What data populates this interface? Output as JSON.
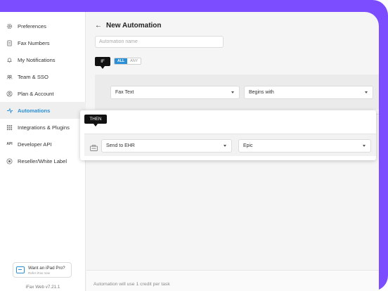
{
  "sidebar": {
    "items": [
      {
        "label": "Preferences",
        "icon": "gear-icon"
      },
      {
        "label": "Fax Numbers",
        "icon": "fax-icon"
      },
      {
        "label": "My Notifications",
        "icon": "bell-icon"
      },
      {
        "label": "Team & SSO",
        "icon": "team-icon"
      },
      {
        "label": "Plan & Account",
        "icon": "account-icon"
      },
      {
        "label": "Automations",
        "icon": "automation-icon",
        "active": true
      },
      {
        "label": "Integrations & Plugins",
        "icon": "grid-icon"
      },
      {
        "label": "Developer API",
        "icon": "api-icon"
      },
      {
        "label": "Reseller/White Label",
        "icon": "globe-icon"
      }
    ],
    "promo": {
      "title": "Want an iPad Pro?",
      "subtitle": "Refer iFax now"
    },
    "version": "iFax Web v7.21.1"
  },
  "main": {
    "title": "New Automation",
    "back_icon": "arrow-left-icon",
    "name_placeholder": "Automation name",
    "name_value": "",
    "if_label": "IF",
    "toggle": {
      "all": "ALL",
      "any": "ANY",
      "selected": "ALL"
    },
    "condition": {
      "field": "Fax Text",
      "operator": "Begins with"
    },
    "then_label": "THEN",
    "action": {
      "type": "Send to EHR",
      "target": "Epic"
    },
    "footer_note": "Automation will use 1 credit per task"
  },
  "colors": {
    "accent": "#2b8fd8",
    "frame": "#7c4dff",
    "tag": "#111111"
  }
}
